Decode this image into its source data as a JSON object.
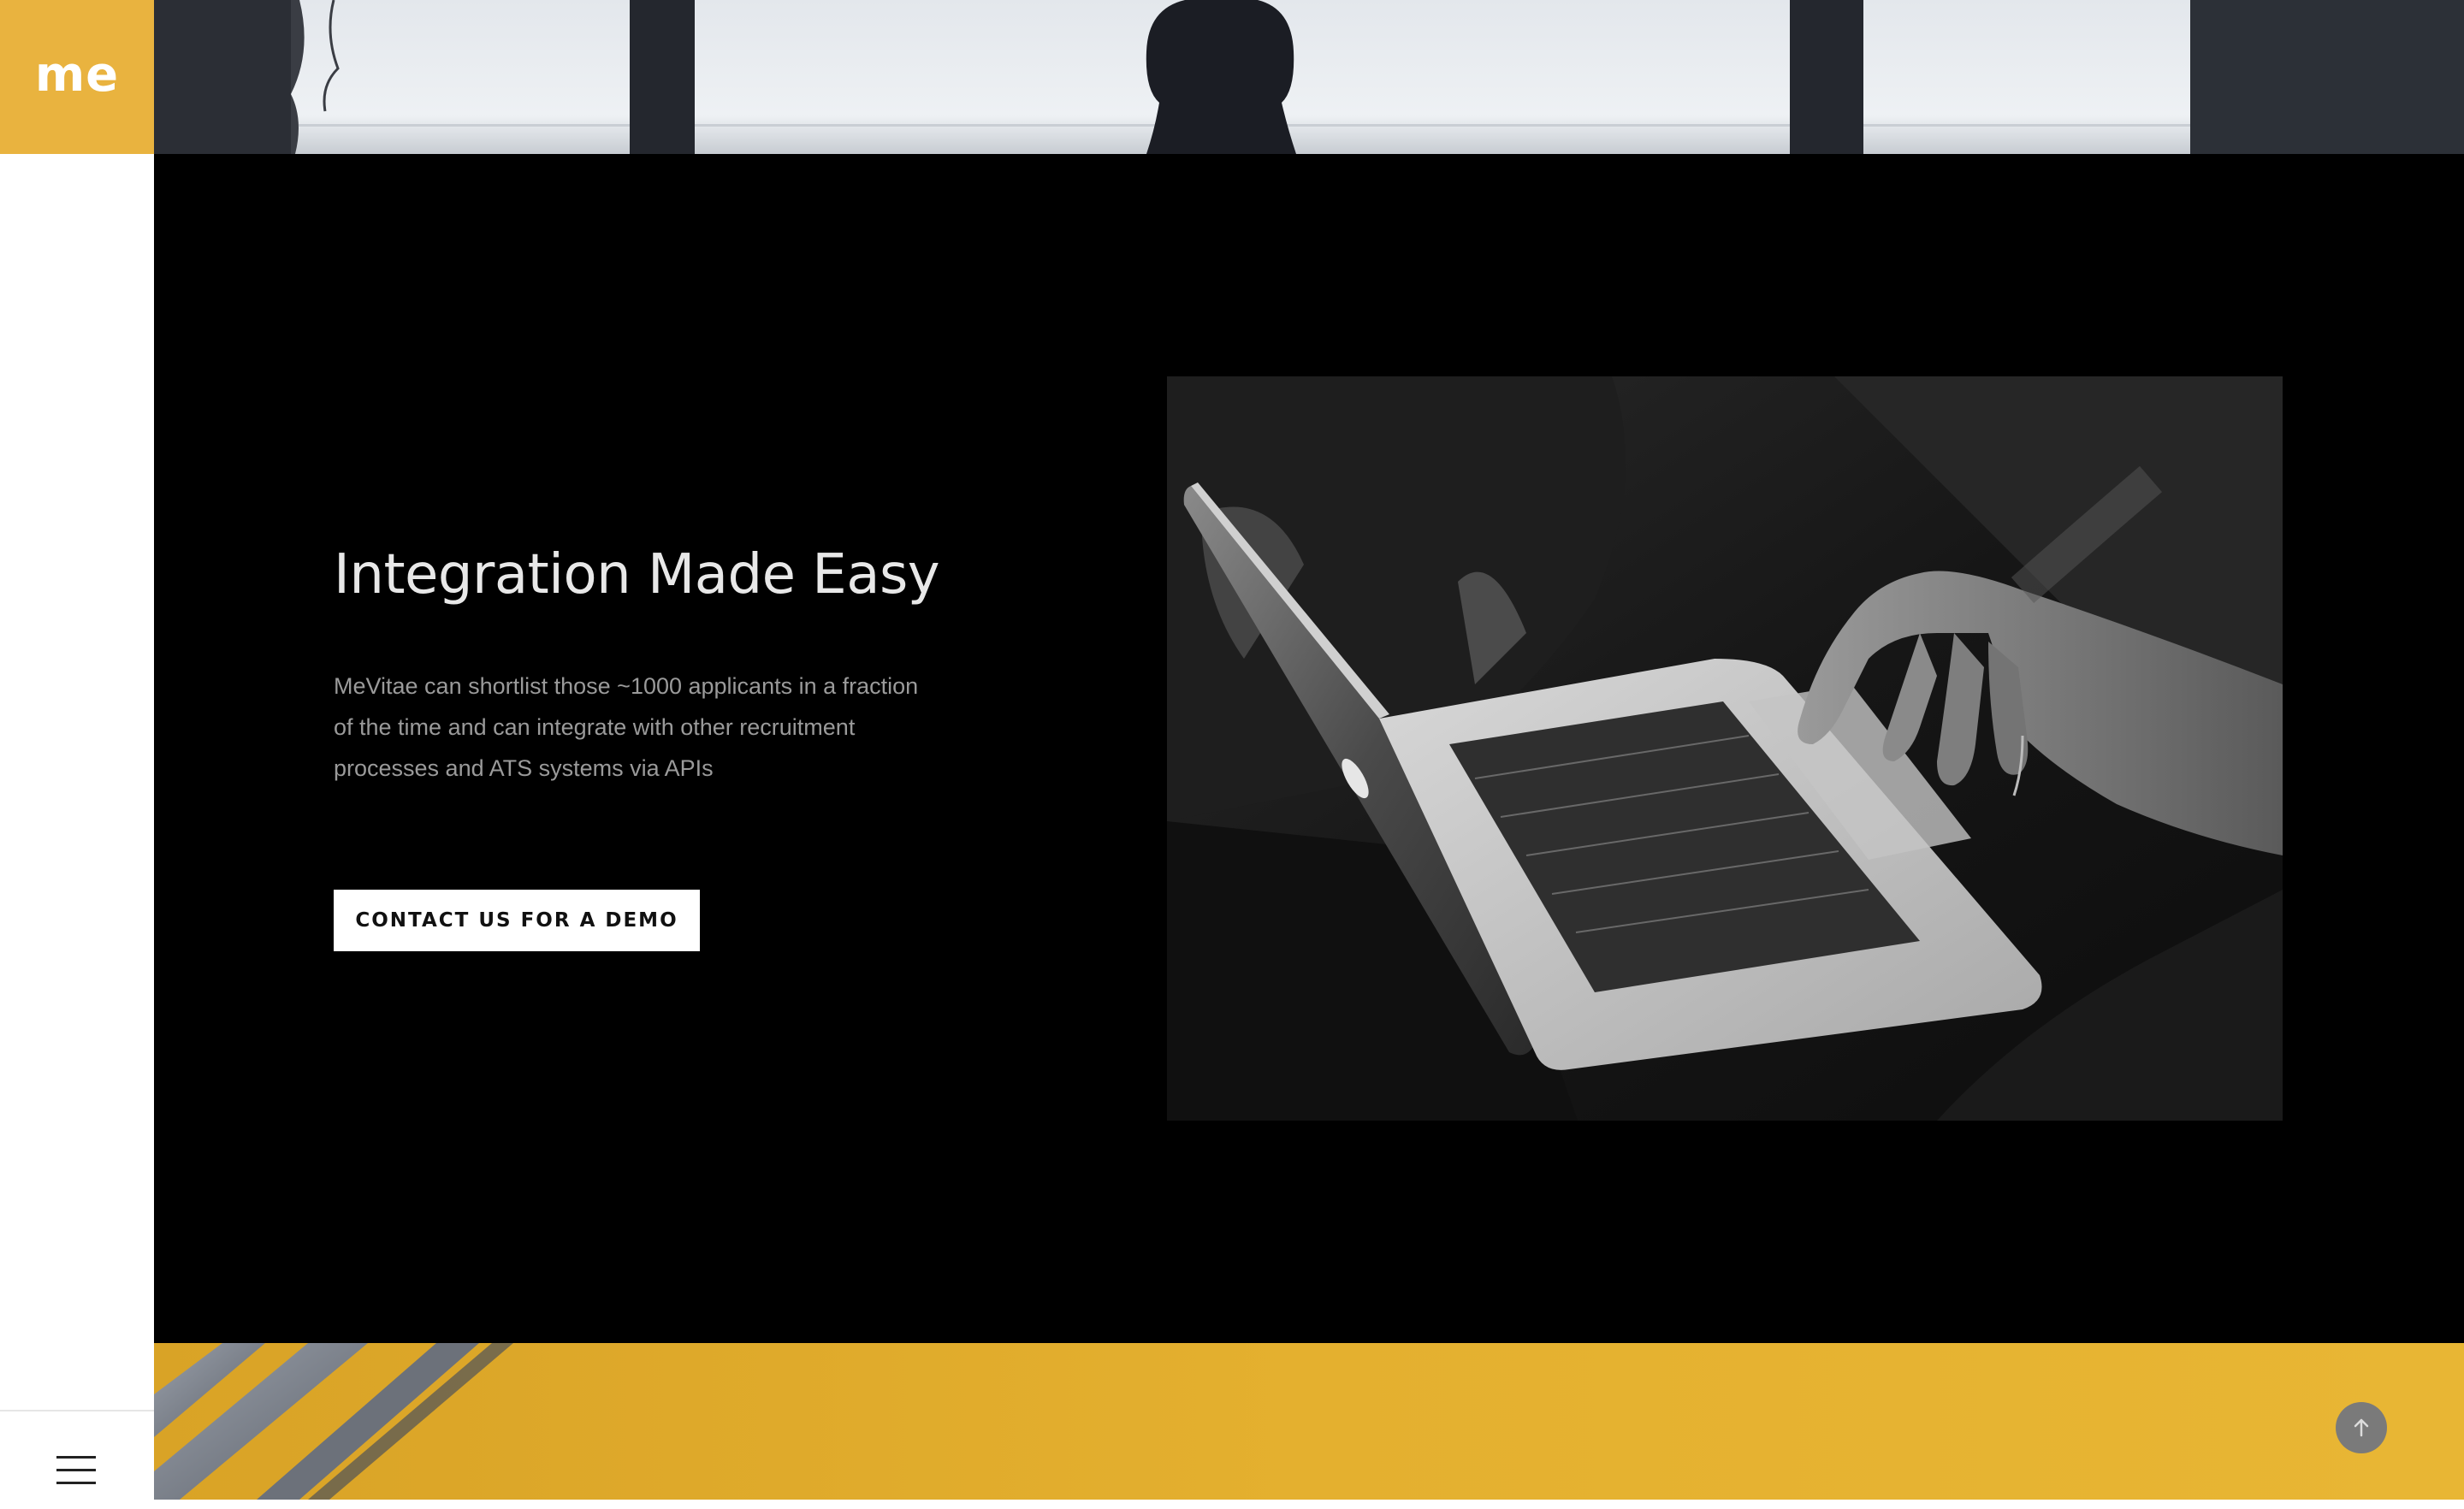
{
  "logo": {
    "text": "me"
  },
  "hero": {
    "title": "Integration Made Easy",
    "description": "MeVitae can shortlist those ~1000 applicants in a fraction of the time and can integrate with other recruitment processes and ATS systems via APIs",
    "cta_label": "CONTACT US FOR A DEMO"
  },
  "icons": {
    "menu": "hamburger-menu-icon",
    "scroll_top": "arrow-up-icon"
  },
  "colors": {
    "brand_yellow": "#e9b33f",
    "hero_background": "#000000",
    "cta_background": "#ffffff",
    "scroll_button": "#7a7a7a"
  }
}
